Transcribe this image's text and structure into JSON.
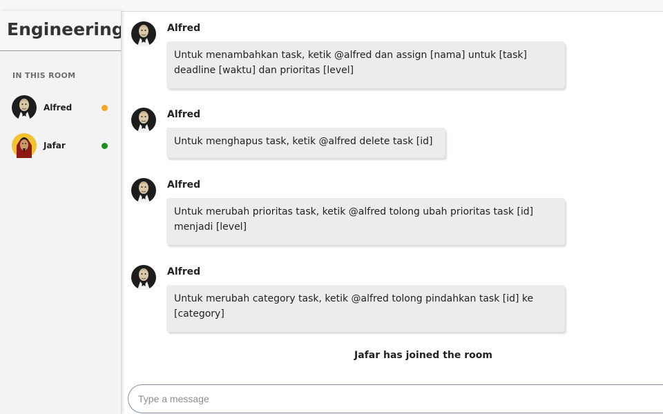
{
  "sidebar": {
    "room_name": "Engineering",
    "section_label": "IN THIS ROOM",
    "members": [
      {
        "name": "Alfred",
        "status_color": "#f5a623",
        "avatar": "alfred-avatar"
      },
      {
        "name": "Jafar",
        "status_color": "#1a8f1a",
        "avatar": "jafar-avatar"
      }
    ]
  },
  "messages": [
    {
      "sender": "Alfred",
      "text": "Untuk menambahkan task, ketik @alfred dan assign [nama] untuk [task] deadline [waktu] dan prioritas [level]"
    },
    {
      "sender": "Alfred",
      "text": "Untuk menghapus task, ketik @alfred delete task [id]"
    },
    {
      "sender": "Alfred",
      "text": "Untuk merubah prioritas task, ketik @alfred tolong ubah prioritas task [id] menjadi [level]"
    },
    {
      "sender": "Alfred",
      "text": "Untuk merubah category task, ketik @alfred tolong pindahkan task [id] ke [category]"
    }
  ],
  "system_note": "Jafar has joined the room",
  "composer": {
    "placeholder": "Type a message",
    "value": ""
  }
}
